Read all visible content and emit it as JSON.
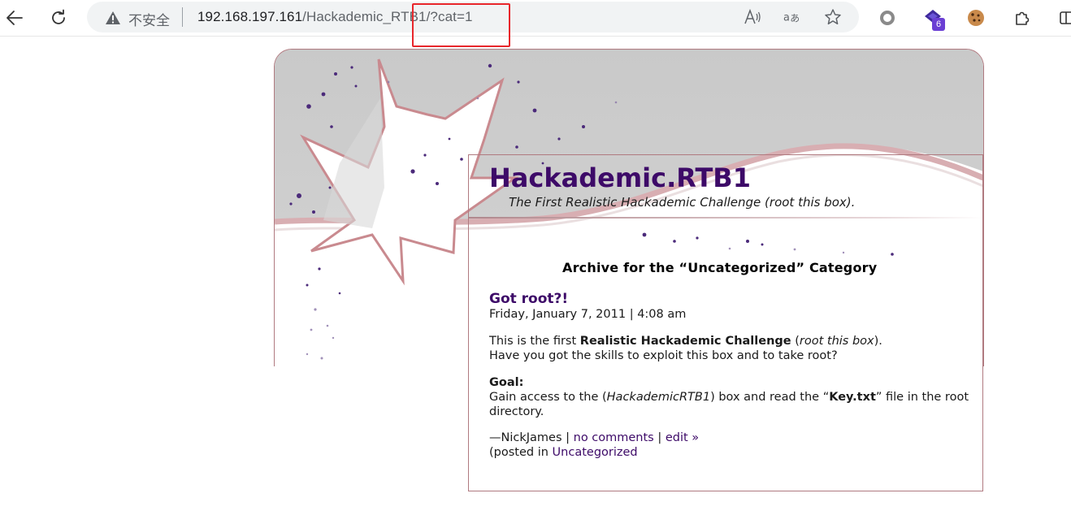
{
  "browser": {
    "insecure_label": "不安全",
    "url_host": "192.168.197.161",
    "url_path": "/Hackademic_RTB1",
    "url_query": "/?cat=1",
    "extension_badge": "6",
    "highlight_color": "#e8262b"
  },
  "site": {
    "title": "Hackademic.RTB1",
    "description": "The First Realistic Hackademic Challenge (root this box).",
    "accent_color": "#3d0a68"
  },
  "archive": {
    "heading": "Archive for the “Uncategorized” Category"
  },
  "post": {
    "title": "Got root?!",
    "date": "Friday, January 7, 2011 | 4:08 am",
    "para1_prefix": "This is the first ",
    "para1_bold": "Realistic Hackademic Challenge",
    "para1_mid": " (",
    "para1_italic": "root this box",
    "para1_suffix": ").",
    "para1_line2": "Have you got the skills to exploit this box and to take root?",
    "goal_label": "Goal:",
    "goal_prefix": "Gain access to the (",
    "goal_italic": "HackademicRTB1",
    "goal_mid": ") box and read the “",
    "goal_bold": "Key.txt",
    "goal_suffix": "” file in the root directory.",
    "author": "—NickJames | ",
    "comments_link": "no comments",
    "meta_sep": " | ",
    "edit_link": "edit »",
    "posted_in_prefix": "(posted in ",
    "category_link": "Uncategorized"
  },
  "icons": [
    "back-arrow-icon",
    "refresh-icon",
    "warning-icon",
    "read-aloud-icon",
    "translate-icon",
    "favorite-star-icon",
    "record-icon",
    "extension-purple-icon",
    "cookie-icon",
    "puzzle-icon",
    "split-screen-icon"
  ]
}
